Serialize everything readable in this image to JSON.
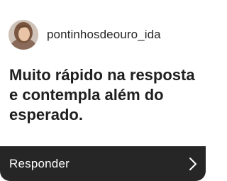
{
  "post": {
    "username": "pontinhosdeouro_ida",
    "avatar_icon": "profile-photo",
    "message": "Muito rápido na resposta e contempla além do esperado."
  },
  "footer": {
    "reply_label": "Responder",
    "chevron_icon": "chevron-right-icon",
    "background_color": "#262626"
  }
}
